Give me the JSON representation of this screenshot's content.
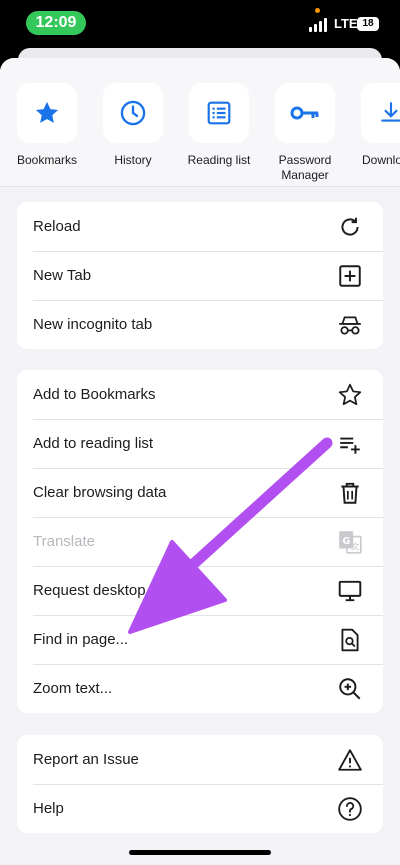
{
  "status_bar": {
    "time": "12:09",
    "network": "LTE",
    "battery": "18"
  },
  "quick_actions": [
    {
      "label": "Bookmarks",
      "icon": "star-filled-icon"
    },
    {
      "label": "History",
      "icon": "clock-icon"
    },
    {
      "label": "Reading list",
      "icon": "list-icon"
    },
    {
      "label": "Password Manager",
      "icon": "key-icon"
    },
    {
      "label": "Downlo",
      "icon": "download-icon"
    }
  ],
  "menu_group_1": [
    {
      "label": "Reload",
      "icon": "reload-icon"
    },
    {
      "label": "New Tab",
      "icon": "plus-square-icon"
    },
    {
      "label": "New incognito tab",
      "icon": "incognito-icon"
    }
  ],
  "menu_group_2": [
    {
      "label": "Add to Bookmarks",
      "icon": "star-outline-icon"
    },
    {
      "label": "Add to reading list",
      "icon": "list-add-icon"
    },
    {
      "label": "Clear browsing data",
      "icon": "trash-icon"
    },
    {
      "label": "Translate",
      "icon": "translate-icon",
      "disabled": true
    },
    {
      "label": "Request desktop",
      "icon": "desktop-icon"
    },
    {
      "label": "Find in page...",
      "icon": "find-in-page-icon"
    },
    {
      "label": "Zoom text...",
      "icon": "zoom-in-icon"
    }
  ],
  "menu_group_3": [
    {
      "label": "Report an Issue",
      "icon": "warning-icon"
    },
    {
      "label": "Help",
      "icon": "help-icon"
    }
  ],
  "colors": {
    "accent": "#1a73e8",
    "annotation_arrow": "#b14ff0",
    "status_pill": "#34c759"
  }
}
